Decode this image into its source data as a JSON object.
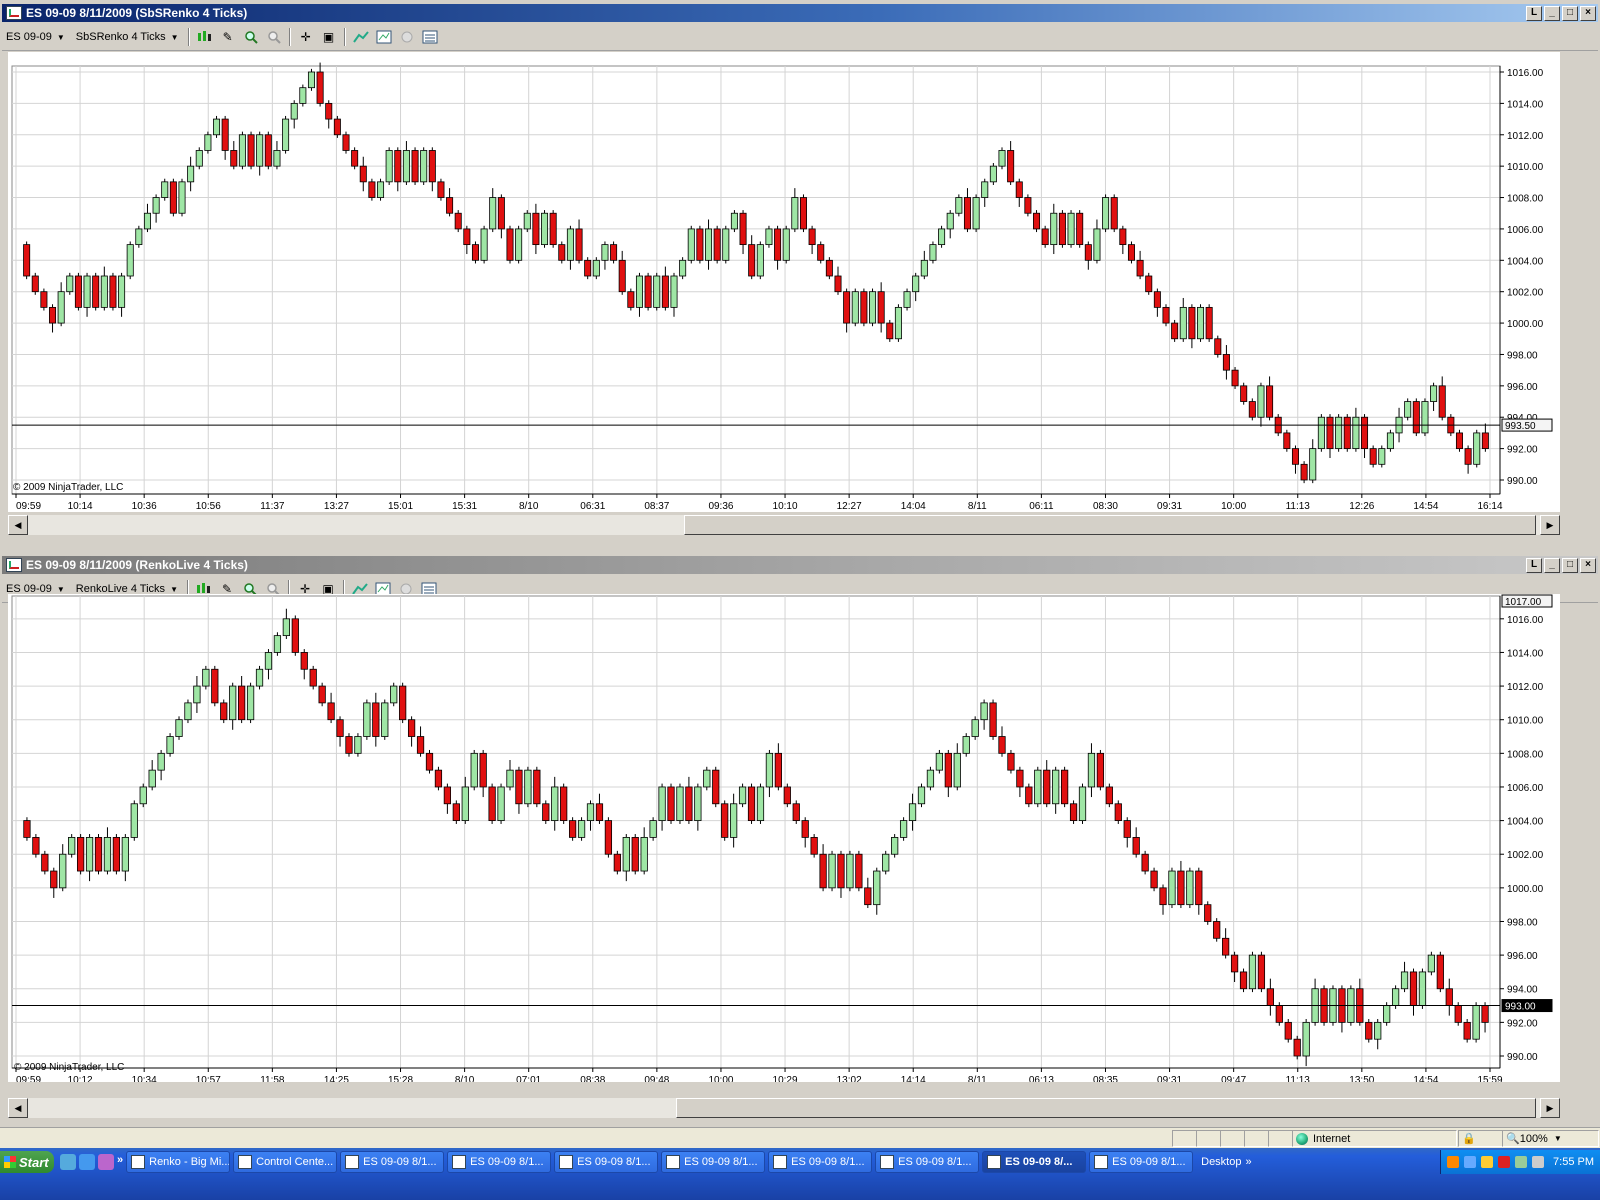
{
  "colors": {
    "up": "#9fe6a5",
    "down": "#e01010",
    "grid": "#d4d4d4",
    "titleActive": "#0a246a",
    "titleInactive": "#7a7a7a"
  },
  "window1": {
    "title": "ES 09-09  8/11/2009 (SbSRenko 4 Ticks)",
    "instrument": "ES 09-09",
    "bartype": "SbSRenko 4 Ticks",
    "copyright": "© 2009 NinjaTrader, LLC",
    "price_tag": "993.50",
    "xlabels": [
      "09:59",
      "10:14",
      "10:36",
      "10:56",
      "11:37",
      "13:27",
      "15:01",
      "15:31",
      "8/10",
      "06:31",
      "08:37",
      "09:36",
      "10:10",
      "12:27",
      "14:04",
      "8/11",
      "06:11",
      "08:30",
      "09:31",
      "10:00",
      "11:13",
      "12:26",
      "14:54",
      "16:14"
    ]
  },
  "window2": {
    "title": "ES 09-09  8/11/2009 (RenkoLive 4 Ticks)",
    "instrument": "ES 09-09",
    "bartype": "RenkoLive 4 Ticks",
    "copyright": "© 2009 NinjaTrader, LLC",
    "price_tag": "993.00",
    "top_tag": "1017.00",
    "xlabels": [
      "09:59",
      "10:12",
      "10:34",
      "10:57",
      "11:58",
      "14:25",
      "15:28",
      "8/10",
      "07:01",
      "08:38",
      "09:48",
      "10:00",
      "10:29",
      "13:02",
      "14:14",
      "8/11",
      "06:13",
      "08:35",
      "09:31",
      "09:47",
      "11:13",
      "13:50",
      "14:54",
      "15:59"
    ]
  },
  "chart_data": [
    {
      "type": "candlestick",
      "title": "ES 09-09  8/11/2009 (SbSRenko 4 Ticks)",
      "ylim": [
        990,
        1016
      ],
      "yticks": [
        "1016.00",
        "1014.00",
        "1012.00",
        "1010.00",
        "1008.00",
        "1006.00",
        "1004.00",
        "1002.00",
        "1000.00",
        "998.00",
        "996.00",
        "994.00",
        "992.00",
        "990.00"
      ],
      "close_levels": [
        1005,
        1003,
        1002,
        1001,
        1000,
        1002,
        1003,
        1001,
        1003,
        1001,
        1003,
        1001,
        1003,
        1005,
        1006,
        1007,
        1008,
        1009,
        1007,
        1009,
        1010,
        1011,
        1012,
        1013,
        1011,
        1010,
        1012,
        1010,
        1012,
        1010,
        1011,
        1013,
        1014,
        1015,
        1016,
        1014,
        1013,
        1012,
        1011,
        1010,
        1009,
        1008,
        1009,
        1011,
        1009,
        1011,
        1009,
        1011,
        1009,
        1008,
        1007,
        1006,
        1005,
        1004,
        1006,
        1008,
        1006,
        1004,
        1006,
        1007,
        1005,
        1007,
        1005,
        1004,
        1006,
        1004,
        1003,
        1004,
        1005,
        1004,
        1002,
        1001,
        1003,
        1001,
        1003,
        1001,
        1003,
        1004,
        1006,
        1004,
        1006,
        1004,
        1006,
        1007,
        1005,
        1003,
        1005,
        1006,
        1004,
        1006,
        1008,
        1006,
        1005,
        1004,
        1003,
        1002,
        1000,
        1002,
        1000,
        1002,
        1000,
        999,
        1001,
        1002,
        1003,
        1004,
        1005,
        1006,
        1007,
        1008,
        1006,
        1008,
        1009,
        1010,
        1011,
        1009,
        1008,
        1007,
        1006,
        1005,
        1007,
        1005,
        1007,
        1005,
        1004,
        1006,
        1008,
        1006,
        1005,
        1004,
        1003,
        1002,
        1001,
        1000,
        999,
        1001,
        999,
        1001,
        999,
        998,
        997,
        996,
        995,
        994,
        996,
        994,
        993,
        992,
        991,
        990,
        992,
        994,
        992,
        994,
        992,
        994,
        992,
        991,
        992,
        993,
        994,
        995,
        993,
        995,
        996,
        994,
        993,
        992,
        991,
        993,
        992
      ]
    },
    {
      "type": "candlestick",
      "title": "ES 09-09  8/11/2009 (RenkoLive 4 Ticks)",
      "ylim": [
        990,
        1017
      ],
      "yticks": [
        "1016.00",
        "1014.00",
        "1012.00",
        "1010.00",
        "1008.00",
        "1006.00",
        "1004.00",
        "1002.00",
        "1000.00",
        "998.00",
        "996.00",
        "994.00",
        "992.00",
        "990.00"
      ],
      "close_levels": [
        1004,
        1003,
        1002,
        1001,
        1000,
        1002,
        1003,
        1001,
        1003,
        1001,
        1003,
        1001,
        1003,
        1005,
        1006,
        1007,
        1008,
        1009,
        1010,
        1011,
        1012,
        1013,
        1011,
        1010,
        1012,
        1010,
        1012,
        1013,
        1014,
        1015,
        1016,
        1014,
        1013,
        1012,
        1011,
        1010,
        1009,
        1008,
        1009,
        1011,
        1009,
        1011,
        1012,
        1010,
        1009,
        1008,
        1007,
        1006,
        1005,
        1004,
        1006,
        1008,
        1006,
        1004,
        1006,
        1007,
        1005,
        1007,
        1005,
        1004,
        1006,
        1004,
        1003,
        1004,
        1005,
        1004,
        1002,
        1001,
        1003,
        1001,
        1003,
        1004,
        1006,
        1004,
        1006,
        1004,
        1006,
        1007,
        1005,
        1003,
        1005,
        1006,
        1004,
        1006,
        1008,
        1006,
        1005,
        1004,
        1003,
        1002,
        1000,
        1002,
        1000,
        1002,
        1000,
        999,
        1001,
        1002,
        1003,
        1004,
        1005,
        1006,
        1007,
        1008,
        1006,
        1008,
        1009,
        1010,
        1011,
        1009,
        1008,
        1007,
        1006,
        1005,
        1007,
        1005,
        1007,
        1005,
        1004,
        1006,
        1008,
        1006,
        1005,
        1004,
        1003,
        1002,
        1001,
        1000,
        999,
        1001,
        999,
        1001,
        999,
        998,
        997,
        996,
        995,
        994,
        996,
        994,
        993,
        992,
        991,
        990,
        992,
        994,
        992,
        994,
        992,
        994,
        992,
        991,
        992,
        993,
        994,
        995,
        993,
        995,
        996,
        994,
        993,
        992,
        991,
        993,
        992
      ]
    }
  ],
  "statusbar": {
    "zone": "Internet",
    "zoom": "100%"
  },
  "taskbar": {
    "start": "Start",
    "buttons": [
      "Renko - Big Mi...",
      "Control Cente...",
      "ES 09-09  8/1...",
      "ES 09-09  8/1...",
      "ES 09-09  8/1...",
      "ES 09-09  8/1...",
      "ES 09-09  8/1...",
      "ES 09-09  8/1...",
      "ES 09-09  8/...",
      "ES 09-09  8/1..."
    ],
    "desktop": "Desktop",
    "clock": "7:55 PM"
  }
}
